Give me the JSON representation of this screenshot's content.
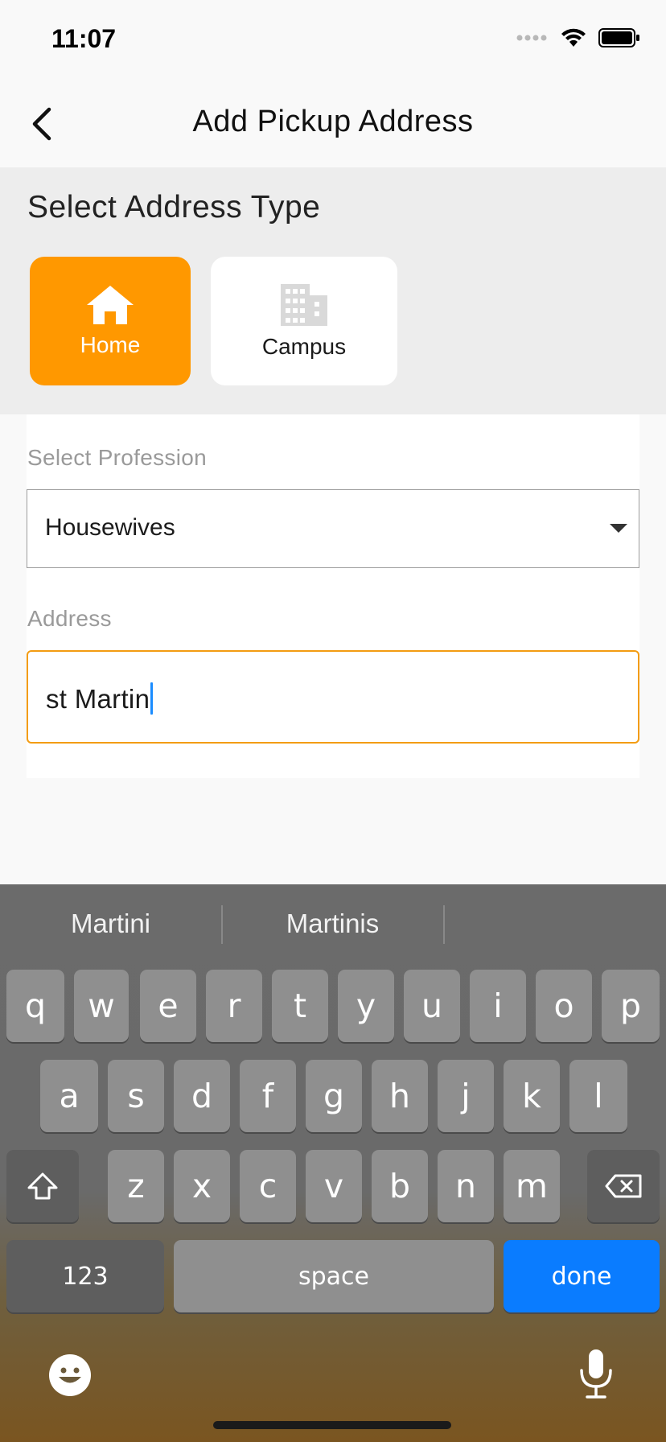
{
  "status_bar": {
    "time": "11:07"
  },
  "nav": {
    "title": "Add Pickup Address",
    "back_icon": "chevron-left-icon"
  },
  "address_type": {
    "heading": "Select Address Type",
    "selected": "Home",
    "options": [
      {
        "label": "Home",
        "icon": "home-icon"
      },
      {
        "label": "Campus",
        "icon": "building-icon"
      }
    ],
    "accent_color": "#ff9800"
  },
  "form": {
    "profession": {
      "label": "Select Profession",
      "value": "Housewives"
    },
    "address": {
      "label": "Address",
      "value": "st Martin",
      "focus_color": "#f39c12"
    }
  },
  "keyboard": {
    "suggestions": [
      "Martini",
      "Martinis",
      ""
    ],
    "rows": [
      [
        "q",
        "w",
        "e",
        "r",
        "t",
        "y",
        "u",
        "i",
        "o",
        "p"
      ],
      [
        "a",
        "s",
        "d",
        "f",
        "g",
        "h",
        "j",
        "k",
        "l"
      ],
      [
        "z",
        "x",
        "c",
        "v",
        "b",
        "n",
        "m"
      ]
    ],
    "numbers_label": "123",
    "space_label": "space",
    "done_label": "done",
    "done_color": "#0a7cff"
  }
}
